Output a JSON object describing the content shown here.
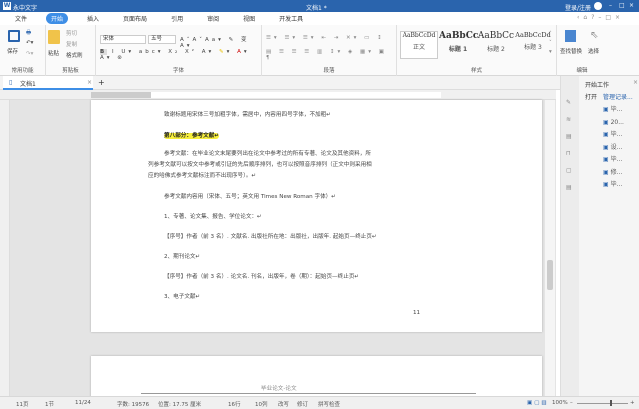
{
  "app": {
    "name": "永中文字",
    "doc_title": "文档1 *",
    "user": "登录/注册"
  },
  "menu": [
    "文件",
    "开始",
    "插入",
    "页面布局",
    "引用",
    "审阅",
    "视图",
    "开发工具"
  ],
  "ribbon": {
    "common": {
      "save": "保存",
      "label": "常用功能"
    },
    "clipboard": {
      "paste": "粘贴",
      "cut": "剪切",
      "copy": "复制",
      "format_painter": "格式刷",
      "label": "剪贴板"
    },
    "font": {
      "name": "宋体",
      "size": "五号",
      "label": "字体"
    },
    "paragraph": {
      "label": "段落"
    },
    "styles": {
      "items": [
        {
          "sample": "AaBbCcDd",
          "name": "正文"
        },
        {
          "sample": "AaBbCc",
          "name": "标题 1"
        },
        {
          "sample": "AaBbCc",
          "name": "标题 2"
        },
        {
          "sample": "AaBbCcDd",
          "name": "标题 3"
        }
      ],
      "label": "样式"
    },
    "edit": {
      "find_replace": "查找替换",
      "select": "选择",
      "label": "编辑"
    }
  },
  "tab": {
    "name": "文档1",
    "new": "+"
  },
  "document": {
    "lines": [
      "致谢标题用宋体三号加粗字体，需居中，内容用四号字体，不加粗↵",
      "第八部分：参考文献↵",
      "参考文献：在毕业论文末尾要列出在论文中参考过的所有专著、论文及其他资料，所",
      "列参考文献可以按文中参考或引证的先后顺序排列，也可以按照音序排列（正文中则采用相",
      "应的哈佛式参考文献标注而不出现序号）。↵",
      "参考文献内容用（宋体、五号；英文用 Times New Roman 字体）↵",
      "1、专著、论文集、报告、学位论文：↵",
      "【序号】作者（前 3 名）. 文献名. 出版社所在地：出版社，出版年. 起始页—终止页↵",
      "2、期刊论文↵",
      "【序号】作者（前 3 名）. 论文名. 刊名，出版年，卷（期）：起始页—终止页↵",
      "3、电子文献↵"
    ],
    "page_number": "11",
    "next_header": "毕业论文-论文"
  },
  "panel": {
    "title": "开始工作",
    "open": "打开",
    "manage": "管理记录...",
    "files": [
      "毕...",
      "20...",
      "毕...",
      "设...",
      "毕...",
      "修...",
      "毕..."
    ]
  },
  "status": {
    "page": "11页",
    "section": "1节",
    "pages": "11/24",
    "words": "字数: 19576",
    "position": "位置: 17.75 厘米",
    "row": "16行",
    "col": "10列",
    "mode": "改写",
    "revise": "修订",
    "spell": "拼写检查",
    "zoom": "100%"
  }
}
